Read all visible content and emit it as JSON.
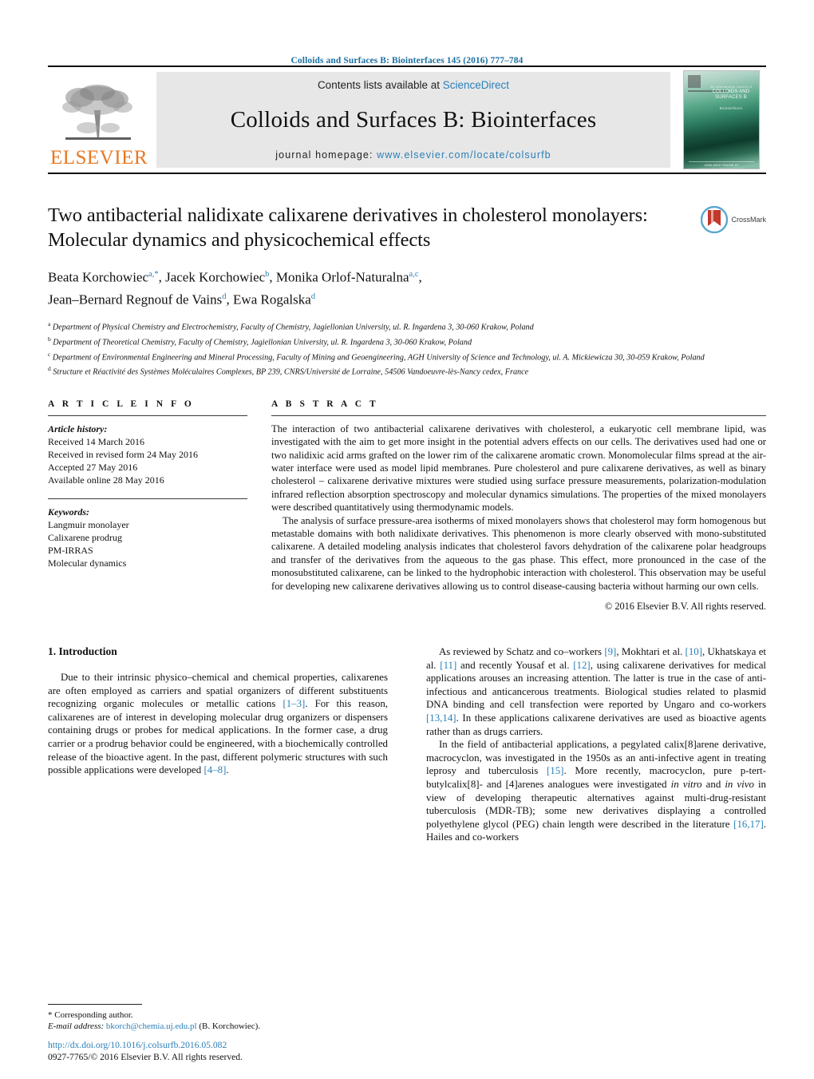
{
  "running_head": "Colloids and Surfaces B: Biointerfaces 145 (2016) 777–784",
  "masthead": {
    "publisher_name": "ELSEVIER",
    "contents_prefix": "Contents lists available at ",
    "contents_link": "ScienceDirect",
    "journal_title": "Colloids and Surfaces B: Biointerfaces",
    "homepage_prefix": "journal homepage: ",
    "homepage_url": "www.elsevier.com/locate/colsurfb",
    "cover_title_small": "An International Journal of",
    "cover_title": "COLLOIDS AND SURFACES B",
    "cover_sub": "Biointerfaces",
    "cover_footer": "AVAILABLE ONLINE AT WWW.SCIENCEDIRECT.COM"
  },
  "article": {
    "title": "Two antibacterial nalidixate calixarene derivatives in cholesterol monolayers: Molecular dynamics and physicochemical effects",
    "crossmark_label": "CrossMark",
    "authors": [
      {
        "name": "Beata Korchowiec",
        "marks": "a,*",
        "sep": ", "
      },
      {
        "name": "Jacek Korchowiec",
        "marks": "b",
        "sep": ", "
      },
      {
        "name": "Monika Orlof-Naturalna",
        "marks": "a,c",
        "sep": ","
      },
      {
        "name": "Jean–Bernard Regnouf de Vains",
        "marks": "d",
        "sep": ", "
      },
      {
        "name": "Ewa Rogalska",
        "marks": "d",
        "sep": ""
      }
    ],
    "affiliations": [
      {
        "mark": "a",
        "text": "Department of Physical Chemistry and Electrochemistry, Faculty of Chemistry, Jagiellonian University, ul. R. Ingardena 3, 30-060 Krakow, Poland"
      },
      {
        "mark": "b",
        "text": "Department of Theoretical Chemistry, Faculty of Chemistry, Jagiellonian University, ul. R. Ingardena 3, 30-060 Krakow, Poland"
      },
      {
        "mark": "c",
        "text": "Department of Environmental Engineering and Mineral Processing, Faculty of Mining and Geoengineering, AGH University of Science and Technology, ul. A. Mickiewicza 30, 30-059 Krakow, Poland"
      },
      {
        "mark": "d",
        "text": "Structure et Réactivité des Systèmes Moléculaires Complexes, BP 239, CNRS/Université de Lorraine, 54506 Vandoeuvre-lès-Nancy cedex, France"
      }
    ]
  },
  "article_info": {
    "heading": "A R T I C L E    I N F O",
    "history_label": "Article history:",
    "history": [
      "Received 14 March 2016",
      "Received in revised form 24 May 2016",
      "Accepted 27 May 2016",
      "Available online 28 May 2016"
    ],
    "keywords_label": "Keywords:",
    "keywords": [
      "Langmuir monolayer",
      "Calixarene prodrug",
      "PM-IRRAS",
      "Molecular dynamics"
    ]
  },
  "abstract": {
    "heading": "A B S T R A C T",
    "paragraphs": [
      "The interaction of two antibacterial calixarene derivatives with cholesterol, a eukaryotic cell membrane lipid, was investigated with the aim to get more insight in the potential advers effects on our cells. The derivatives used had one or two nalidixic acid arms grafted on the lower rim of the calixarene aromatic crown. Monomolecular films spread at the air-water interface were used as model lipid membranes. Pure cholesterol and pure calixarene derivatives, as well as binary cholesterol – calixarene derivative mixtures were studied using surface pressure measurements, polarization-modulation infrared reflection absorption spectroscopy and molecular dynamics simulations. The properties of the mixed monolayers were described quantitatively using thermodynamic models.",
      "The analysis of surface pressure-area isotherms of mixed monolayers shows that cholesterol may form homogenous but metastable domains with both nalidixate derivatives. This phenomenon is more clearly observed with mono-substituted calixarene. A detailed modeling analysis indicates that cholesterol favors dehydration of the calixarene polar headgroups and transfer of the derivatives from the aqueous to the gas phase. This effect, more pronounced in the case of the monosubstituted calixarene, can be linked to the hydrophobic interaction with cholesterol. This observation may be useful for developing new calixarene derivatives allowing us to control disease-causing bacteria without harming our own cells."
    ],
    "copyright": "© 2016 Elsevier B.V. All rights reserved."
  },
  "body": {
    "section_heading": "1. Introduction",
    "left_paragraph_parts": [
      "Due to their intrinsic physico–chemical and chemical properties, calixarenes are often employed as carriers and spatial organizers of different substituents recognizing organic molecules or metallic cations ",
      "[1–3]",
      ". For this reason, calixarenes are of interest in developing molecular drug organizers or dispensers containing drugs or probes for medical applications. In the former case, a drug carrier or a prodrug behavior could be engineered, with a biochemically controlled release of the bioactive agent. In the past, different polymeric structures with such possible applications were developed ",
      "[4–8]",
      "."
    ],
    "right_paragraph1_parts": [
      "As reviewed by Schatz and co–workers ",
      "[9]",
      ", Mokhtari et al. ",
      "[10]",
      ", Ukhatskaya et al. ",
      "[11]",
      " and recently Yousaf et al. ",
      "[12]",
      ", using calixarene derivatives for medical applications arouses an increasing attention. The latter is true in the case of anti-infectious and anticancerous treatments. Biological studies related to plasmid DNA binding and cell transfection were reported by Ungaro and co-workers ",
      "[13,14]",
      ". In these applications calixarene derivatives are used as bioactive agents rather than as drugs carriers."
    ],
    "right_paragraph2_parts": [
      "In the field of antibacterial applications, a pegylated calix[8]arene derivative, macrocyclon, was investigated in the 1950s as an anti-infective agent in treating leprosy and tuberculosis ",
      "[15]",
      ". More recently, macrocyclon, pure p-tert-butylcalix[8]- and [4]arenes analogues were investigated ",
      "in vitro",
      " and ",
      "in vivo",
      " in view of developing therapeutic alternatives against multi-drug-resistant tuberculosis (MDR-TB); some new derivatives displaying a controlled polyethylene glycol (PEG) chain length were described in the literature ",
      "[16,17]",
      ". Hailes and co-workers"
    ]
  },
  "footnotes": {
    "corresponding": "* Corresponding author.",
    "email_label": "E-mail address:",
    "email": "bkorch@chemia.uj.edu.pl",
    "email_suffix": " (B. Korchowiec).",
    "doi": "http://dx.doi.org/10.1016/j.colsurfb.2016.05.082",
    "issn_line": "0927-7765/© 2016 Elsevier B.V. All rights reserved."
  },
  "colors": {
    "link_blue": "#2a7fb8",
    "elsevier_orange": "#E87722",
    "banner_gray": "#e7e7e7"
  }
}
